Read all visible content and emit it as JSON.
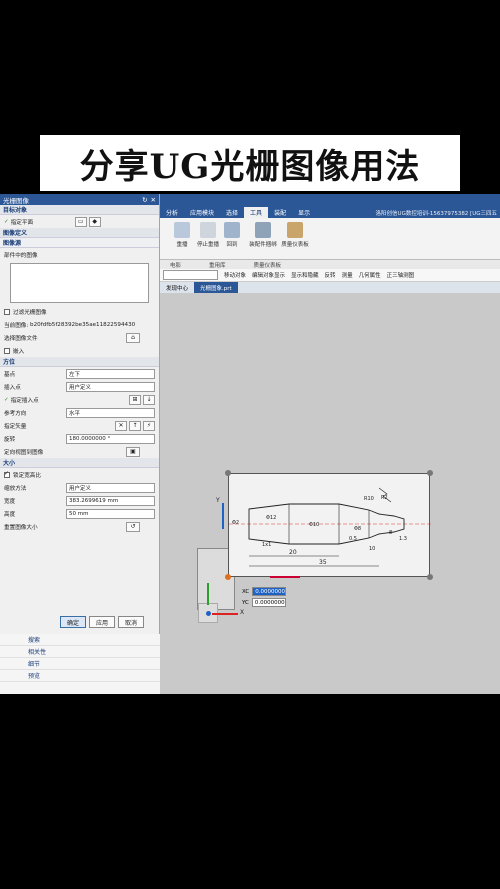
{
  "banner": {
    "title": "分享UG光栅图像用法"
  },
  "dialog": {
    "title": "光栅图像",
    "sections": {
      "target": "目标对象",
      "target_plane": "指定平面",
      "image_def": "图像定义",
      "image_source": "图像源",
      "part_images": "部件中的图像",
      "filter_label": "过滤光栅图像",
      "current_image_label": "当前图像:",
      "current_image_value": "b20fdfb5f28392be35ae11822594430",
      "select_file": "选择图像文件",
      "tile": "嵌入",
      "orientation": "方位",
      "base_point_label": "基点",
      "base_point_value": "左下",
      "insert_point_label": "插入点",
      "insert_point_value": "用户定义",
      "specify_insert": "指定插入点",
      "ref_dir_label": "参考方向",
      "ref_dir_value": "水平",
      "specify_vector": "指定矢量",
      "rotate_label": "旋转",
      "rotate_value": "180.0000000",
      "rotate_unit": "°",
      "to_view": "定向视图到图像",
      "size": "大小",
      "lock_aspect": "锁定宽高比",
      "scale_method_label": "缩放方法",
      "scale_method_value": "用户定义",
      "width_label": "宽度",
      "width_value": "383.2699619",
      "width_unit": "mm",
      "height_label": "高度",
      "height_value": "50",
      "height_unit": "mm",
      "reset_size": "重置图像大小"
    },
    "buttons": {
      "ok": "确定",
      "apply": "应用",
      "cancel": "取消"
    },
    "lower_items": [
      "搜索",
      "相关性",
      "细节",
      "预览"
    ]
  },
  "ribbon": {
    "tabs": [
      "分析",
      "应用模块",
      "选择",
      "工具",
      "装配",
      "显示"
    ],
    "active_tab": "工具",
    "status": "洛阳创信UG数控培训-15637975382 [UG三四五",
    "buttons": [
      "重播",
      "停止重播",
      "回到",
      "装配件捆绑",
      "质量仪表板"
    ],
    "groups": [
      "电影",
      "重用库",
      "质量仪表板"
    ]
  },
  "cmdbar": {
    "filter_value": "",
    "items": [
      "移动对象",
      "编辑对象显示",
      "显示和隐藏",
      "反转",
      "测量",
      "几何属性",
      "正三轴测图"
    ]
  },
  "doctabs": {
    "items": [
      "发现中心",
      "光栅图象.prt"
    ],
    "active": 1
  },
  "coords": {
    "xc_label": "XC",
    "xc_value": "0.0000000",
    "yc_label": "YC",
    "yc_value": "0.0000000"
  },
  "drawing": {
    "dims": [
      "Φ12",
      "R2",
      "1x1",
      "20",
      "35",
      "Φ10",
      "Φ8",
      "R10",
      "0.5",
      "10",
      "1.3",
      "Φ2",
      "8"
    ],
    "axis_x": "X",
    "axis_y": "Y"
  }
}
